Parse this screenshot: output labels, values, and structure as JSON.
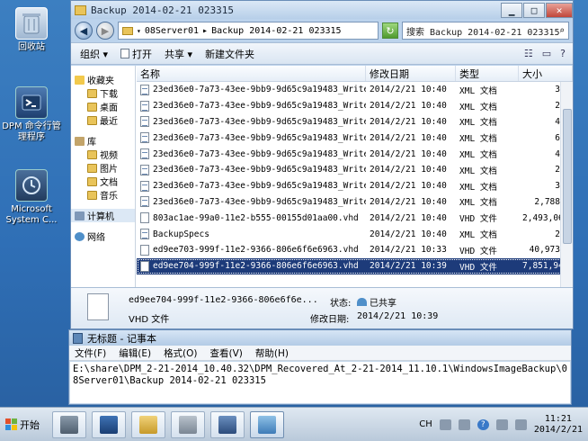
{
  "desktop": {
    "icons": [
      {
        "label": "回收站"
      },
      {
        "label": "DPM 命令行管理程序"
      },
      {
        "label": "Microsoft System C..."
      }
    ]
  },
  "explorer": {
    "title": "Backup 2014-02-21 023315",
    "address": {
      "segments": [
        "08Server01",
        "Backup 2014-02-21 023315"
      ],
      "separator": "▸"
    },
    "search": {
      "placeholder": "搜索 Backup 2014-02-21 023315"
    },
    "toolbar": {
      "organize": "组织 ▾",
      "open": "打开",
      "share": "共享 ▾",
      "new_folder": "新建文件夹"
    },
    "nav": {
      "favorites": "收藏夹",
      "downloads": "下载",
      "desktop": "桌面",
      "recent": "最近",
      "libraries": "库",
      "videos": "视频",
      "pictures": "图片",
      "documents": "文档",
      "music": "音乐",
      "computer": "计算机",
      "network": "网络"
    },
    "columns": {
      "name": "名称",
      "date": "修改日期",
      "type": "类型",
      "size": "大小"
    },
    "files": [
      {
        "name": "23ed36e0-7a73-43ee-9bb9-9d65c9a19483_Writer2...",
        "date": "2014/2/21 10:40",
        "type": "XML 文档",
        "size": "3"
      },
      {
        "name": "23ed36e0-7a73-43ee-9bb9-9d65c9a19483_Writera...",
        "date": "2014/2/21 10:40",
        "type": "XML 文档",
        "size": "2"
      },
      {
        "name": "23ed36e0-7a73-43ee-9bb9-9d65c9a19483_Writera...",
        "date": "2014/2/21 10:40",
        "type": "XML 文档",
        "size": "4"
      },
      {
        "name": "23ed36e0-7a73-43ee-9bb9-9d65c9a19483_Writerb...",
        "date": "2014/2/21 10:40",
        "type": "XML 文档",
        "size": "6"
      },
      {
        "name": "23ed36e0-7a73-43ee-9bb9-9d65c9a19483_Writerb...",
        "date": "2014/2/21 10:40",
        "type": "XML 文档",
        "size": "4"
      },
      {
        "name": "23ed36e0-7a73-43ee-9bb9-9d65c9a19483_Writerb...",
        "date": "2014/2/21 10:40",
        "type": "XML 文档",
        "size": "2"
      },
      {
        "name": "23ed36e0-7a73-43ee-9bb9-9d65c9a19483_Writerd...",
        "date": "2014/2/21 10:40",
        "type": "XML 文档",
        "size": "3"
      },
      {
        "name": "23ed36e0-7a73-43ee-9bb9-9d65c9a19483_Writerf...",
        "date": "2014/2/21 10:40",
        "type": "XML 文档",
        "size": "2,788"
      },
      {
        "name": "803ac1ae-99a0-11e2-b555-00155d01aa00.vhd",
        "date": "2014/2/21 10:40",
        "type": "VHD 文件",
        "size": "2,493,06"
      },
      {
        "name": "BackupSpecs",
        "date": "2014/2/21 10:40",
        "type": "XML 文档",
        "size": "2"
      },
      {
        "name": "ed9ee703-999f-11e2-9366-806e6f6e6963.vhd",
        "date": "2014/2/21 10:33",
        "type": "VHD 文件",
        "size": "40,973"
      },
      {
        "name": "ed9ee704-999f-11e2-9366-806e6f6e6963.vhd",
        "date": "2014/2/21 10:39",
        "type": "VHD 文件",
        "size": "7,851,94"
      }
    ],
    "selected_index": 11,
    "details": {
      "name": "ed9ee704-999f-11e2-9366-806e6f6e...",
      "type": "VHD 文件",
      "state_label": "状态:",
      "state_value": "已共享",
      "date_label": "修改日期:",
      "date_value": "2014/2/21 10:39"
    }
  },
  "notepad": {
    "title": "无标题 - 记事本",
    "menu": [
      "文件(F)",
      "编辑(E)",
      "格式(O)",
      "查看(V)",
      "帮助(H)"
    ],
    "content": "E:\\share\\DPM_2-21-2014_10.40.32\\DPM_Recovered_At_2-21-2014_11.10.1\\WindowsImageBackup\\08Server01\\Backup 2014-02-21 023315"
  },
  "taskbar": {
    "start": "开始",
    "lang": "CH",
    "time": "11:21",
    "date": "2014/2/21"
  },
  "colors": {
    "desktop": "#2f6fb6",
    "selection": "#1d3b7a",
    "close_button": "#c0463a"
  }
}
